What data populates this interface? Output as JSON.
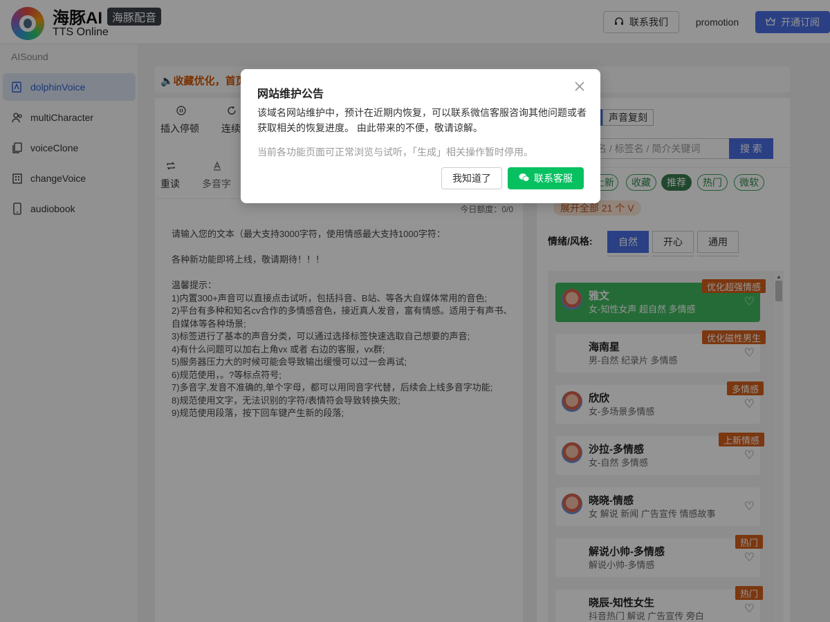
{
  "header": {
    "brand_title": "海豚AI",
    "brand_tag": "海豚配音",
    "brand_sub": "TTS Online",
    "contact_label": "联系我们",
    "promo_label": "promotion",
    "subscribe_label": "开通订阅"
  },
  "sidebar": {
    "title": "AISound",
    "items": [
      {
        "label": "dolphinVoice"
      },
      {
        "label": "multiCharacter"
      },
      {
        "label": "voiceClone"
      },
      {
        "label": "changeVoice"
      },
      {
        "label": "audiobook"
      }
    ]
  },
  "notice": {
    "text": "🔈收藏优化，首页"
  },
  "editor": {
    "tools": [
      {
        "label": "插入停顿"
      },
      {
        "label": "连续"
      },
      {
        "label": "重读"
      },
      {
        "label": "多音字"
      }
    ],
    "quota": "今日额度：0/0",
    "text": "请输入您的文本（最大支持3000字符，使用情感最大支持1000字符：\n\n各种新功能即将上线，敬请期待！！！\n\n温馨提示：\n1)内置300+声音可以直接点击试听，包括抖音、B站、等各大自媒体常用的音色;\n2)平台有多种和知名cv合作的多情感音色，接近真人发音，富有情感。适用于有声书、自媒体等各种场景;\n3)标签进行了基本的声音分类，可以通过选择标签快速选取自己想要的声音;\n4)有什么问题可以加右上角vx 或者 右边的客服，vx群;\n5)服务器压力大的时候可能会导致输出缓慢可以过一会再试;\n6)规范使用，。?等标点符号;\n7)多音字,发音不准确的,单个字母，都可以用同音字代替，后续会上线多音字功能;\n8)规范使用文字，无法识别的字符/表情符会导致转换失败;\n9)规范使用段落，按下回车键产生新的段落;"
  },
  "voice_panel": {
    "clone_btn": "声音复刻",
    "search_placeholder": "名 / 标签名 / 简介关键词",
    "search_btn": "搜 索",
    "tags": [
      {
        "label": "上新"
      },
      {
        "label": "收藏"
      },
      {
        "label": "推荐"
      },
      {
        "label": "热门"
      },
      {
        "label": "微软"
      }
    ],
    "expand_label": "展开全部 21 个 V",
    "emotion_label": "情绪/风格:",
    "emotions": [
      {
        "label": "自然"
      },
      {
        "label": "开心"
      },
      {
        "label": "通用"
      }
    ],
    "voices": [
      {
        "name": "雅文",
        "desc": "女-知性女声 超自然 多情感",
        "badge": "优化超强情感"
      },
      {
        "name": "海南星",
        "desc": "男-自然 纪录片 多情感",
        "badge": "优化磁性男生"
      },
      {
        "name": "欣欣",
        "desc": "女-多场景多情感",
        "badge": "多情感"
      },
      {
        "name": "沙拉-多情感",
        "desc": "女-自然 多情感",
        "badge": "上新情感"
      },
      {
        "name": "晓晓-情感",
        "desc": "女 解说 新闻 广告宣传 情感故事",
        "badge": ""
      },
      {
        "name": "解说小帅-多情感",
        "desc": "解说小帅-多情感",
        "badge": "热门"
      },
      {
        "name": "晓辰-知性女生",
        "desc": "抖音热门 解说 广告宣传 旁白",
        "badge": "热门"
      }
    ]
  },
  "modal": {
    "title": "网站维护公告",
    "body": "该域名网站维护中，预计在近期内恢复，可以联系微信客服咨询其他问题或者获取相关的恢复进度。 由此带来的不便，敬请谅解。",
    "note": "当前各功能页面可正常浏览与试听，「生成」相关操作暂时停用。",
    "know_label": "我知道了",
    "cs_label": "联系客服"
  },
  "colors": {
    "primary": "#4a6fe3",
    "green": "#07c160",
    "badge": "#d45f1a"
  }
}
